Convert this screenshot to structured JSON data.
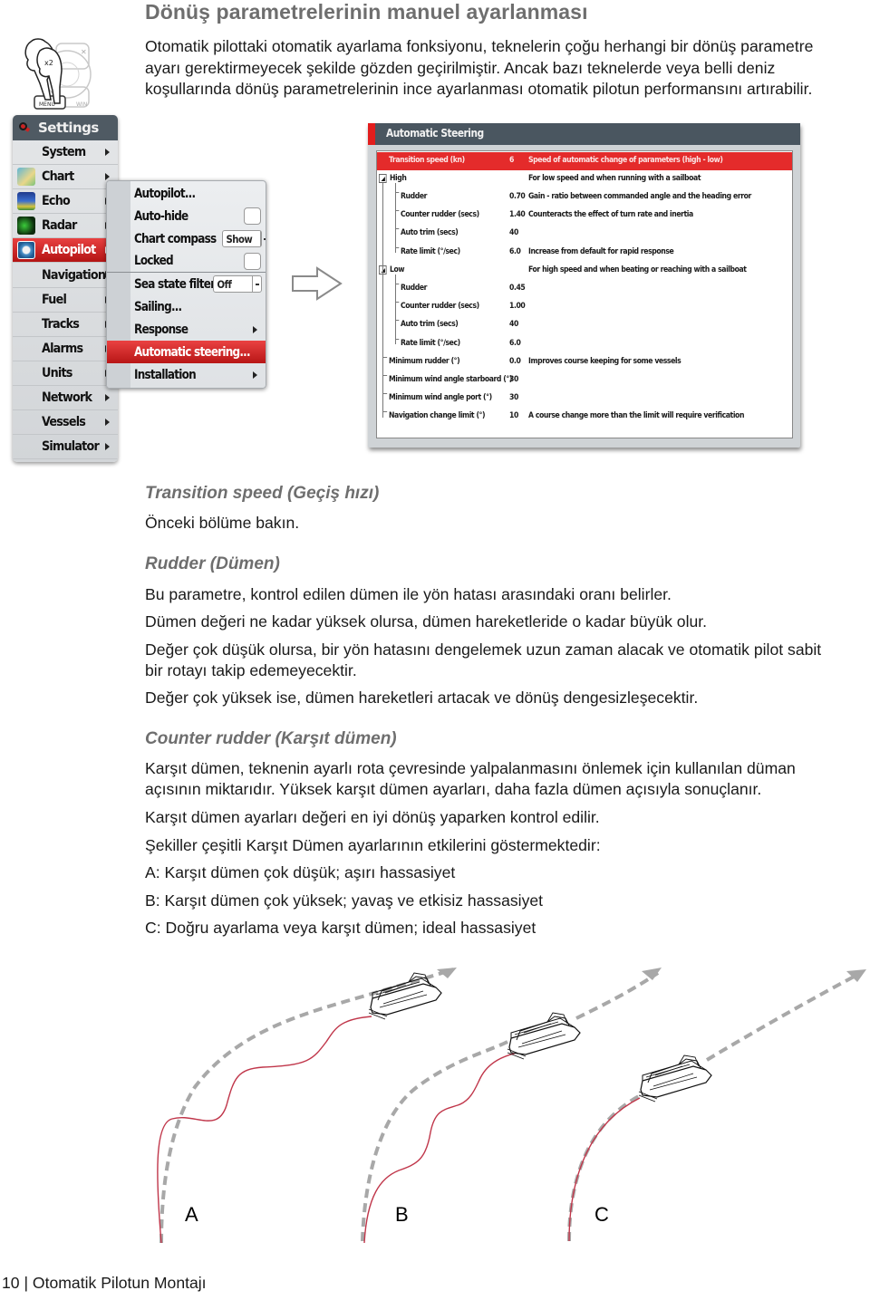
{
  "page": {
    "title": "Dönüş parametrelerinin manuel ayarlanması",
    "intro_lines": [
      "Otomatik pilottaki otomatik ayarlama fonksiyonu, teknelerin çoğu herhangi bir dönüş parametre",
      "ayarı gerektirmeyecek şekilde gözden geçirilmiştir. Ancak bazı teknelerde veya belli deniz",
      "koşullarında dönüş parametrelerinin ince ayarlanması otomatik pilotun performansını artırabilir."
    ],
    "keypad_icon": {
      "label_x2": "x2",
      "key_mfd": "MENU",
      "key_x": "X",
      "key_win": "WIN"
    },
    "footer": "10 | Otomatik Pilotun Montajı"
  },
  "settings_menu": {
    "title": "Settings",
    "items": [
      {
        "label": "System",
        "icon": "none",
        "has_arrow": true
      },
      {
        "label": "Chart",
        "icon": "chart-icon",
        "has_arrow": true
      },
      {
        "label": "Echo",
        "icon": "echo-icon",
        "has_arrow": true
      },
      {
        "label": "Radar",
        "icon": "radar-icon",
        "has_arrow": true
      },
      {
        "label": "Autopilot",
        "icon": "autopilot-icon",
        "has_arrow": true,
        "active": true
      },
      {
        "label": "Navigation",
        "icon": "none",
        "has_arrow": true
      },
      {
        "label": "Fuel",
        "icon": "none",
        "has_arrow": true
      },
      {
        "label": "Tracks",
        "icon": "none",
        "has_arrow": true
      },
      {
        "label": "Alarms",
        "icon": "none",
        "has_arrow": true
      },
      {
        "label": "Units",
        "icon": "none",
        "has_arrow": true
      },
      {
        "label": "Network",
        "icon": "none",
        "has_arrow": true
      },
      {
        "label": "Vessels",
        "icon": "none",
        "has_arrow": true
      },
      {
        "label": "Simulator",
        "icon": "none",
        "has_arrow": true
      }
    ]
  },
  "autopilot_menu": {
    "items": [
      {
        "label": "Autopilot..."
      },
      {
        "label": "Auto-hide",
        "checkbox": false
      },
      {
        "label": "Chart compass",
        "dropdown_value": "Show"
      },
      {
        "label": "Locked",
        "checkbox": false
      },
      {
        "label": "Sea state filter",
        "dropdown_value": "Off"
      },
      {
        "label": "Sailing..."
      },
      {
        "label": "Response",
        "has_arrow": true
      },
      {
        "label": "Automatic steering...",
        "active": true
      },
      {
        "label": "Installation",
        "has_arrow": true
      }
    ]
  },
  "steering_dialog": {
    "title": "Automatic Steering",
    "rows": [
      {
        "name": "Transition speed (kn)",
        "value": "6",
        "desc": "Speed of automatic change of parameters (high - low)",
        "highlight": true
      },
      {
        "name": "High",
        "value": "",
        "desc": "For low speed and when running with a sailboat",
        "group": true
      },
      {
        "name": "Rudder",
        "value": "0.70",
        "desc": "Gain - ratio between commanded angle and the heading error",
        "child": true
      },
      {
        "name": "Counter rudder (secs)",
        "value": "1.40",
        "desc": "Counteracts the effect of turn rate and inertia",
        "child": true
      },
      {
        "name": "Auto trim (secs)",
        "value": "40",
        "desc": "",
        "child": true
      },
      {
        "name": "Rate limit (°/sec)",
        "value": "6.0",
        "desc": "Increase from default for rapid response",
        "child": true
      },
      {
        "name": "Low",
        "value": "",
        "desc": "For high speed and when beating or reaching with a sailboat",
        "group": true
      },
      {
        "name": "Rudder",
        "value": "0.45",
        "desc": "",
        "child": true
      },
      {
        "name": "Counter rudder (secs)",
        "value": "1.00",
        "desc": "",
        "child": true
      },
      {
        "name": "Auto trim (secs)",
        "value": "40",
        "desc": "",
        "child": true
      },
      {
        "name": "Rate limit (°/sec)",
        "value": "6.0",
        "desc": "",
        "child": true
      },
      {
        "name": "Minimum rudder (°)",
        "value": "0.0",
        "desc": "Improves course keeping for some vessels"
      },
      {
        "name": "Minimum wind angle starboard (°)",
        "value": "30",
        "desc": ""
      },
      {
        "name": "Minimum wind angle port (°)",
        "value": "30",
        "desc": ""
      },
      {
        "name": "Navigation change limit (°)",
        "value": "10",
        "desc": "A course change more than the limit will require verification"
      }
    ]
  },
  "sections": {
    "transition": {
      "heading": "Transition speed (Geçiş hızı)",
      "lines": [
        "Önceki bölüme bakın."
      ]
    },
    "rudder": {
      "heading": "Rudder (Dümen)",
      "lines": [
        "Bu parametre, kontrol edilen dümen ile yön hatası arasındaki oranı belirler.",
        "Dümen değeri ne kadar yüksek olursa, dümen hareketleride o kadar büyük olur.",
        "Değer çok düşük olursa, bir yön hatasını dengelemek uzun zaman alacak ve otomatik pilot sabit",
        "bir rotayı takip edemeyecektir.",
        "Değer çok yüksek ise, dümen hareketleri artacak  ve dönüş dengesizleşecektir."
      ]
    },
    "counter": {
      "heading": "Counter rudder (Karşıt dümen)",
      "lines": [
        "Karşıt dümen, teknenin ayarlı rota çevresinde yalpalanmasını önlemek için kullanılan düman",
        "açısının miktarıdır. Yüksek karşıt dümen ayarları, daha fazla dümen açısıyla  sonuçlanır.",
        "Karşıt dümen ayarları değeri en iyi dönüş yaparken kontrol edilir.",
        "Şekiller çeşitli Karşıt Dümen ayarlarının etkilerini göstermektedir:",
        "A: Karşıt dümen çok düşük; aşırı hassasiyet",
        "B: Karşıt dümen çok yüksek; yavaş ve etkisiz hassasiyet",
        "C: Doğru ayarlama veya karşıt dümen; ideal hassasiyet"
      ]
    }
  },
  "diagram": {
    "labels": [
      "A",
      "B",
      "C"
    ],
    "colors": {
      "planned_path": "#a8a8a8",
      "actual_path": "#c0364a",
      "boat_outline": "#111111"
    }
  }
}
